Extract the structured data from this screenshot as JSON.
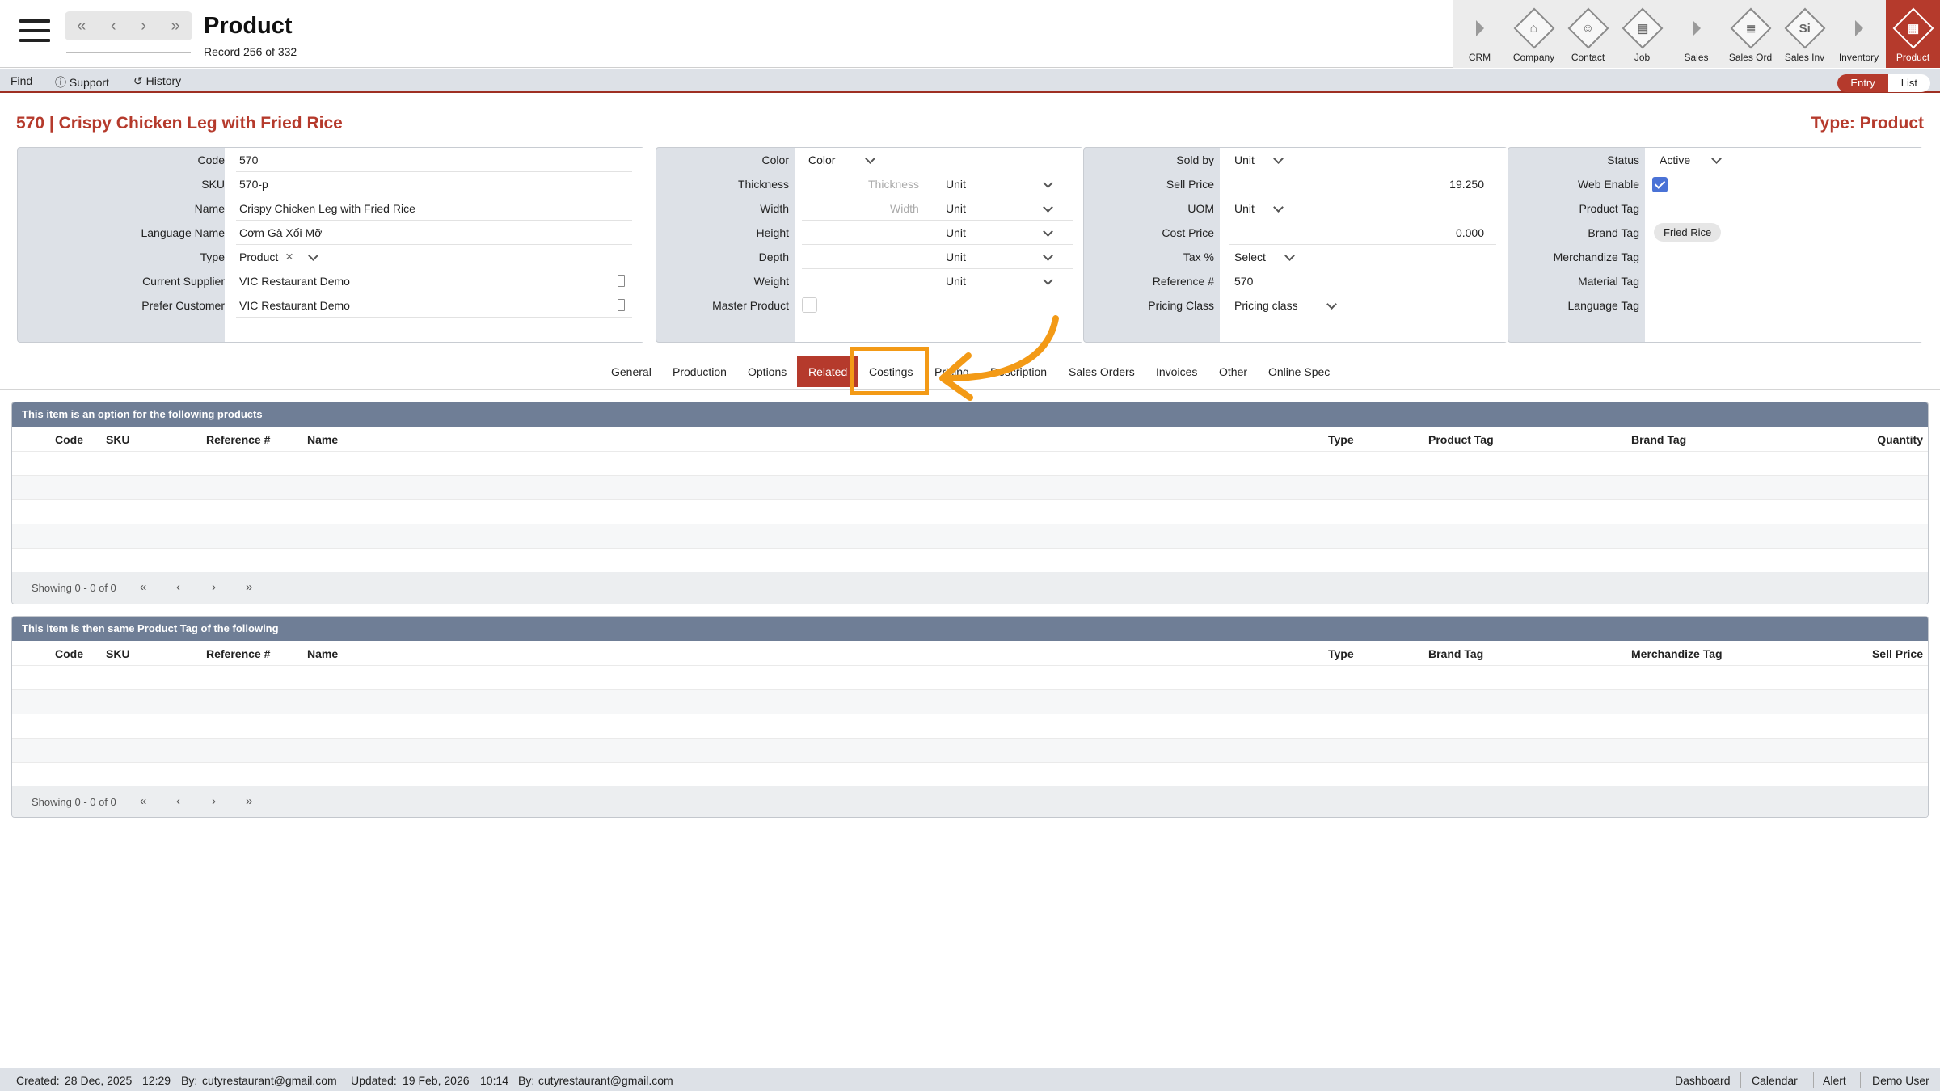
{
  "header": {
    "title": "Product",
    "record": "Record 256 of 332",
    "nav": {
      "first": "«",
      "prev": "‹",
      "next": "›",
      "last": "»"
    }
  },
  "modules": [
    {
      "label": "CRM",
      "icon": "triangle-icon"
    },
    {
      "label": "Company",
      "icon": "company-icon"
    },
    {
      "label": "Contact",
      "icon": "contact-icon"
    },
    {
      "label": "Job",
      "icon": "job-icon"
    },
    {
      "label": "Sales",
      "icon": "triangle-icon"
    },
    {
      "label": "Sales Ord",
      "icon": "sales-order-icon"
    },
    {
      "label": "Sales Inv",
      "icon": "sales-invoice-icon",
      "glyph": "Si"
    },
    {
      "label": "Inventory",
      "icon": "triangle-icon"
    },
    {
      "label": "Product",
      "icon": "product-icon"
    }
  ],
  "toolbar": {
    "find": "Find",
    "support": "Support",
    "history": "History",
    "entry": "Entry",
    "list": "List"
  },
  "record": {
    "title": "570 | Crispy Chicken Leg with Fried Rice",
    "type_label": "Type: Product"
  },
  "form": {
    "code_label": "Code",
    "code": "570",
    "sku_label": "SKU",
    "sku": "570-p",
    "name_label": "Name",
    "name": "Crispy Chicken Leg with Fried Rice",
    "language_name_label": "Language Name",
    "language_name": "Cơm Gà Xối Mỡ",
    "type_label": "Type",
    "type": "Product",
    "current_supplier_label": "Current Supplier",
    "current_supplier": "VIC Restaurant Demo",
    "prefer_customer_label": "Prefer Customer",
    "prefer_customer": "VIC Restaurant Demo",
    "color_label": "Color",
    "color": "Color",
    "thickness_label": "Thickness",
    "thickness_placeholder": "Thickness",
    "thickness_unit": "Unit",
    "width_label": "Width",
    "width_placeholder": "Width",
    "width_unit": "Unit",
    "height_label": "Height",
    "height_unit": "Unit",
    "depth_label": "Depth",
    "depth_unit": "Unit",
    "weight_label": "Weight",
    "weight_unit": "Unit",
    "master_product_label": "Master Product",
    "sold_by_label": "Sold by",
    "sold_by": "Unit",
    "sell_price_label": "Sell Price",
    "sell_price": "19.250",
    "uom_label": "UOM",
    "uom": "Unit",
    "cost_price_label": "Cost Price",
    "cost_price": "0.000",
    "tax_label": "Tax %",
    "tax": "Select",
    "reference_label": "Reference #",
    "reference": "570",
    "pricing_class_label": "Pricing Class",
    "pricing_class": "Pricing class",
    "status_label": "Status",
    "status": "Active",
    "web_enable_label": "Web Enable",
    "web_enable": true,
    "product_tag_label": "Product Tag",
    "brand_tag_label": "Brand Tag",
    "brand_tag": "Fried Rice",
    "merchandize_tag_label": "Merchandize Tag",
    "material_tag_label": "Material Tag",
    "language_tag_label": "Language Tag"
  },
  "tabs": [
    "General",
    "Production",
    "Options",
    "Related",
    "Costings",
    "Pricing",
    "Description",
    "Sales Orders",
    "Invoices",
    "Other",
    "Online Spec"
  ],
  "active_tab": "Related",
  "grid1": {
    "title": "This item is an option for the following products",
    "columns": [
      "Code",
      "SKU",
      "Reference #",
      "Name",
      "Type",
      "Product Tag",
      "Brand Tag",
      "Quantity"
    ],
    "showing": "Showing 0 - 0 of 0"
  },
  "grid2": {
    "title": "This item is then same Product Tag of the following",
    "columns": [
      "Code",
      "SKU",
      "Reference #",
      "Name",
      "Type",
      "Brand Tag",
      "Merchandize Tag",
      "Sell Price"
    ],
    "showing": "Showing 0 - 0 of 0"
  },
  "pager": {
    "first": "«",
    "prev": "‹",
    "next": "›",
    "last": "»"
  },
  "footer": {
    "created_label": "Created:",
    "created_date": "28 Dec, 2025",
    "created_time": "12:29",
    "by_label": "By:",
    "created_by": "cutyrestaurant@gmail.com",
    "updated_label": "Updated:",
    "updated_date": "19 Feb, 2026",
    "updated_time": "10:14",
    "updated_by": "cutyrestaurant@gmail.com",
    "links": [
      "Dashboard",
      "Calendar",
      "Alert",
      "Demo User"
    ]
  },
  "colors": {
    "accent": "#b53a2c",
    "highlight": "#f39a16",
    "grid_header": "#6f7e96",
    "panel": "#dde1e7"
  }
}
